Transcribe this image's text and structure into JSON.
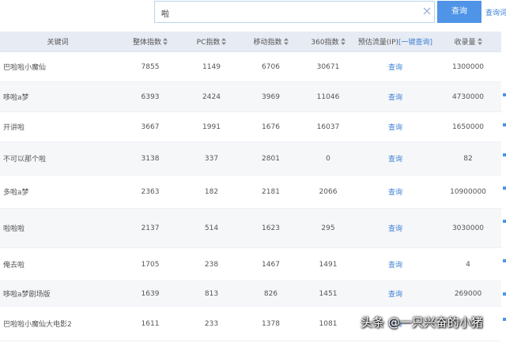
{
  "search": {
    "query": "啦",
    "button_label": "查询",
    "right_link": "查询词"
  },
  "table": {
    "headers": {
      "keyword": "关键词",
      "overall": "整体指数",
      "pc": "PC指数",
      "mobile": "移动指数",
      "i360": "360指数",
      "traffic": "预估流量(IP)",
      "bulk_query": "[一键查询]",
      "indexed": "收录量"
    },
    "query_label": "查询",
    "rows": [
      {
        "keyword": "巴啦啦小魔仙",
        "overall": "7855",
        "pc": "1149",
        "mobile": "6706",
        "i360": "30671",
        "indexed": "1300000"
      },
      {
        "keyword": "哆啦a梦",
        "overall": "6393",
        "pc": "2424",
        "mobile": "3969",
        "i360": "11046",
        "indexed": "4730000"
      },
      {
        "keyword": "开讲啦",
        "overall": "3667",
        "pc": "1991",
        "mobile": "1676",
        "i360": "16037",
        "indexed": "1650000"
      },
      {
        "keyword": "不可以那个啦",
        "overall": "3138",
        "pc": "337",
        "mobile": "2801",
        "i360": "0",
        "indexed": "82"
      },
      {
        "keyword": "多啦a梦",
        "overall": "2363",
        "pc": "182",
        "mobile": "2181",
        "i360": "2066",
        "indexed": "10900000"
      },
      {
        "keyword": "啦啦啦",
        "overall": "2137",
        "pc": "514",
        "mobile": "1623",
        "i360": "295",
        "indexed": "3030000"
      },
      {
        "keyword": "俺去啦",
        "overall": "1705",
        "pc": "238",
        "mobile": "1467",
        "i360": "1491",
        "indexed": "4"
      },
      {
        "keyword": "哆啦a梦剧场版",
        "overall": "1639",
        "pc": "813",
        "mobile": "826",
        "i360": "1451",
        "indexed": "269000"
      },
      {
        "keyword": "巴啦啦小魔仙大电影2",
        "overall": "1611",
        "pc": "233",
        "mobile": "1378",
        "i360": "1081",
        "indexed": ""
      }
    ]
  },
  "watermark": "头条 @一只兴奋的小猪",
  "colors": {
    "accent": "#4f94e6",
    "link": "#3a7fd5",
    "header_bg": "#e7ebf3",
    "alt_row_bg": "#f6f7f9"
  },
  "icons": {
    "clear": "close-icon",
    "sort": "sort-icon"
  }
}
